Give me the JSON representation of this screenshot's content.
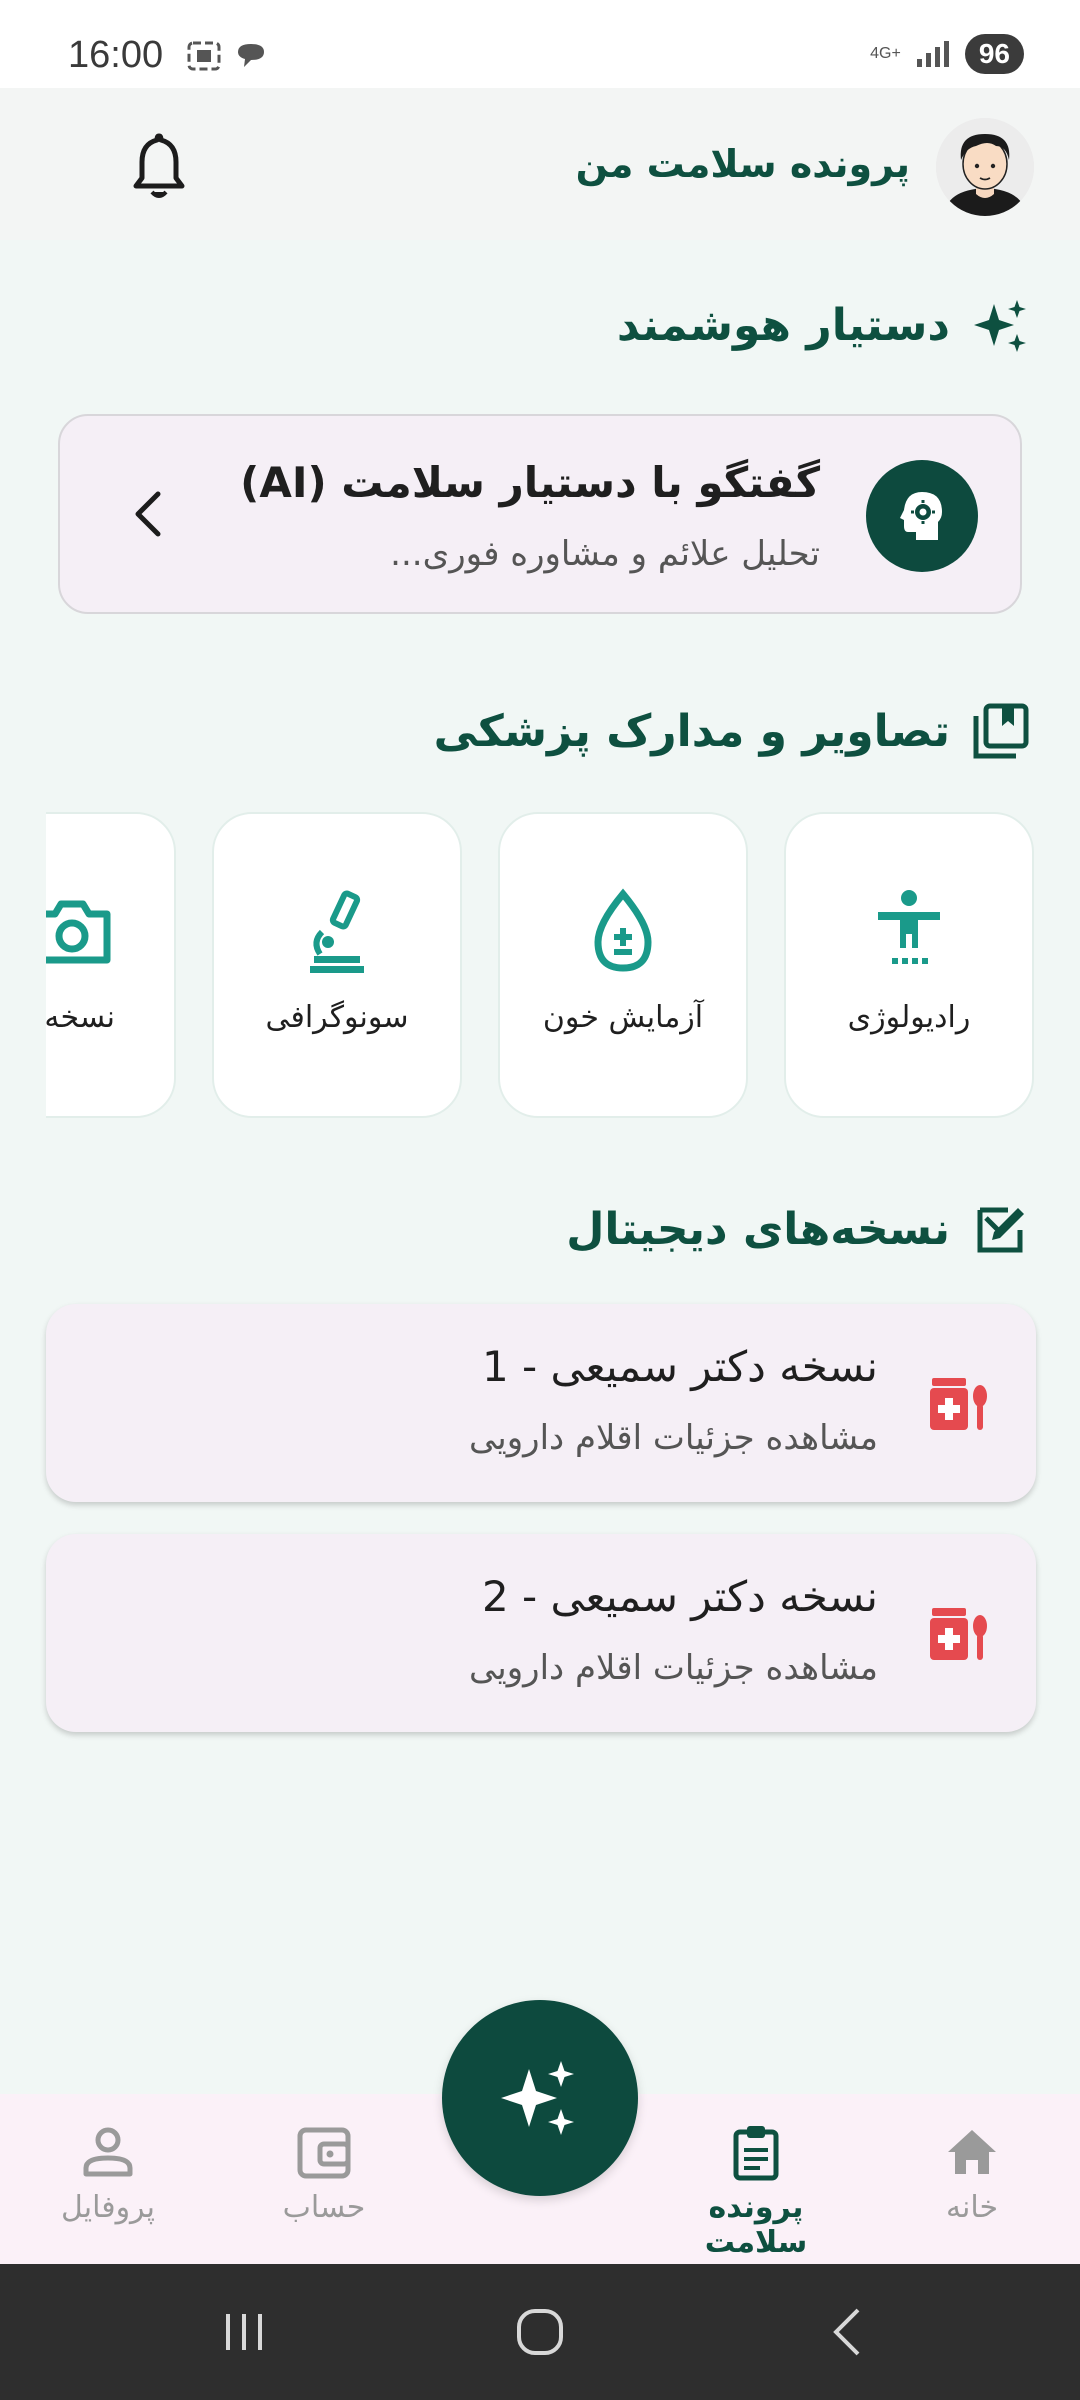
{
  "status_bar": {
    "time": "16:00",
    "network": "4G+",
    "battery": "96"
  },
  "app_bar": {
    "title": "پرونده سلامت من",
    "avatar_icon": "user-avatar-icon",
    "notification_icon": "bell-icon"
  },
  "assistant_section": {
    "title": "دستیار هوشمند",
    "icon": "sparkle-icon",
    "card": {
      "title": "گفتگو با دستیار سلامت (AI)",
      "subtitle": "تحلیل علائم و مشاوره فوری...",
      "icon": "head-gear-icon"
    }
  },
  "documents_section": {
    "title": "تصاویر و مدارک پزشکی",
    "icon": "library-book-icon",
    "items": [
      {
        "label": "رادیولوژی",
        "icon": "body-scan-icon"
      },
      {
        "label": "آزمایش خون",
        "icon": "blood-drop-icon"
      },
      {
        "label": "سونوگرافی",
        "icon": "microscope-icon"
      },
      {
        "label": "نسخه ک",
        "icon": "camera-icon"
      }
    ]
  },
  "prescriptions_section": {
    "title": "نسخه‌های دیجیتال",
    "icon": "edit-note-icon",
    "items": [
      {
        "title": "نسخه دکتر سمیعی - 1",
        "subtitle": "مشاهده جزئیات اقلام دارویی",
        "icon": "medication-icon"
      },
      {
        "title": "نسخه دکتر سمیعی - 2",
        "subtitle": "مشاهده جزئیات اقلام دارویی",
        "icon": "medication-icon"
      }
    ]
  },
  "bottom_nav": {
    "items": [
      {
        "label": "خانه",
        "icon": "home-icon",
        "active": false
      },
      {
        "label": "پرونده سلامت",
        "icon": "clipboard-icon",
        "active": true
      },
      {
        "label": "حساب",
        "icon": "wallet-icon",
        "active": false
      },
      {
        "label": "پروفایل",
        "icon": "person-icon",
        "active": false
      }
    ],
    "fab_icon": "sparkle-icon"
  },
  "colors": {
    "primary": "#0d4a3e",
    "accent_teal": "#1a9a8a",
    "rx_red": "#e54a4f",
    "background": "#f1f7f5"
  }
}
